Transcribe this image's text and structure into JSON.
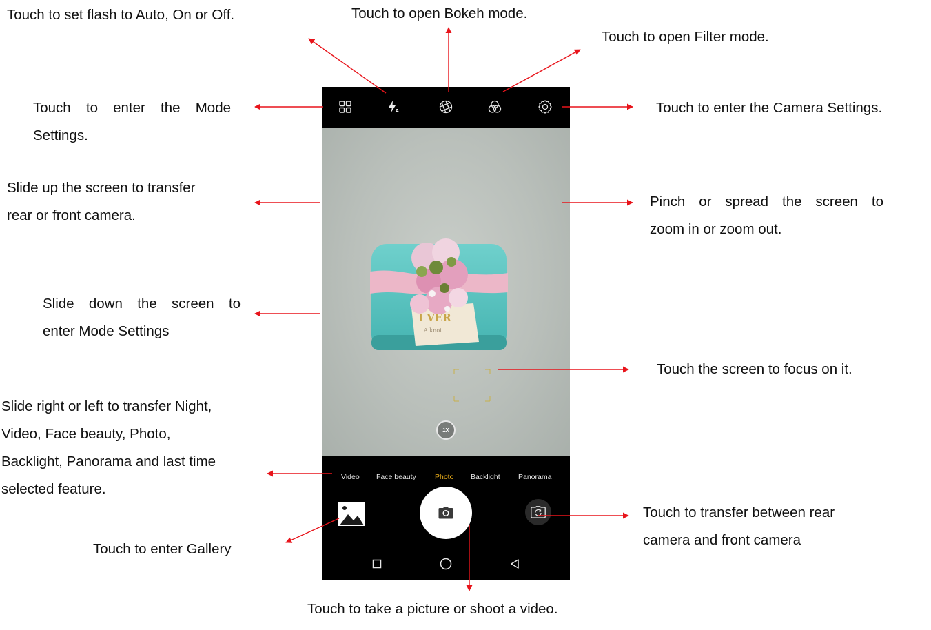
{
  "annotations": {
    "flash": "Touch to set flash to Auto, On or Off.",
    "bokeh": "Touch to open Bokeh mode.",
    "filter": "Touch to open Filter mode.",
    "mode_settings_a": "Touch to enter the Mode",
    "mode_settings_b": "Settings.",
    "camera_settings": "Touch to enter the Camera Settings.",
    "slide_up_a": "Slide up the screen to transfer",
    "slide_up_b": "rear or front camera.",
    "pinch_a": "Pinch or spread the screen to",
    "pinch_b": "zoom in or zoom out.",
    "slide_down_a": "Slide down the screen to",
    "slide_down_b": "enter Mode Settings",
    "focus": "Touch the screen to focus on it.",
    "slide_rl_1": "Slide right or left to transfer Night,",
    "slide_rl_2": "Video, Face beauty, Photo,",
    "slide_rl_3": "Backlight, Panorama and last time",
    "slide_rl_4": "selected feature.",
    "switch_a": "Touch to transfer between rear",
    "switch_b": "camera and front camera",
    "gallery": "Touch to enter Gallery",
    "shutter": "Touch to take a picture or shoot a video."
  },
  "camera": {
    "zoom_level": "1X",
    "modes": [
      "Video",
      "Face beauty",
      "Photo",
      "Backlight",
      "Panorama"
    ],
    "active_mode": "Photo"
  },
  "icons": {
    "top": [
      "mode-grid-icon",
      "flash-auto-icon",
      "bokeh-aperture-icon",
      "filter-icon",
      "settings-gear-icon"
    ],
    "bottom": [
      "gallery-icon",
      "camera-icon",
      "switch-camera-icon"
    ],
    "nav": [
      "recent-apps-icon",
      "home-icon",
      "back-icon"
    ]
  },
  "colors": {
    "arrow": "#e8141b",
    "active_mode": "#f2b31b",
    "phone_bg": "#000000"
  }
}
